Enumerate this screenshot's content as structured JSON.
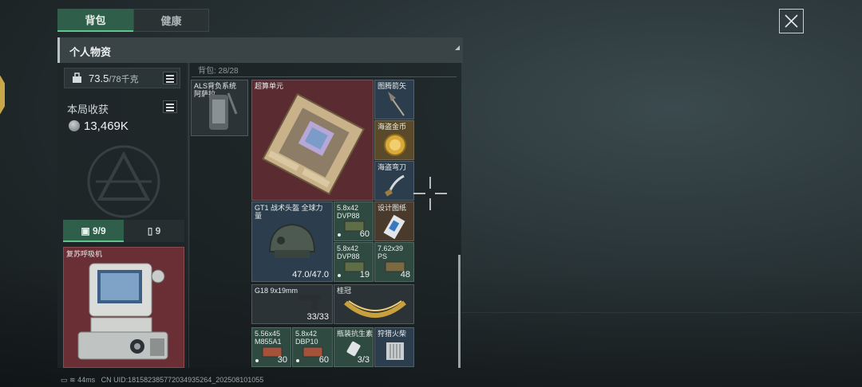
{
  "tabs": [
    "背包",
    "健康"
  ],
  "panel_title": "个人物资",
  "weight": {
    "value": "73.5",
    "max": "/78千克"
  },
  "harvest": {
    "label": "本局收获",
    "value": "13,469K"
  },
  "subtabs": {
    "case": "9/9",
    "other": "9"
  },
  "left_item": {
    "name": "复苏呼吸机"
  },
  "backpack_label": "背包: 28/28",
  "items": [
    {
      "name": "ALS背负系统 阿萨拉…",
      "qty": ""
    },
    {
      "name": "超算单元",
      "qty": ""
    },
    {
      "name": "图腾箭矢",
      "qty": ""
    },
    {
      "name": "海盗金币",
      "qty": ""
    },
    {
      "name": "海盗弯刀",
      "qty": ""
    },
    {
      "name": "GT1 战术头盔 全球力量",
      "qty": "47.0/47.0"
    },
    {
      "name": "5.8x42 DVP88",
      "qty": "60"
    },
    {
      "name": "设计图纸",
      "qty": ""
    },
    {
      "name": "5.8x42 DVP88",
      "qty": "19"
    },
    {
      "name": "7.62x39 PS",
      "qty": "48"
    },
    {
      "name": "G18 9x19mm",
      "qty": "33/33"
    },
    {
      "name": "桂冠",
      "qty": ""
    },
    {
      "name": "5.56x45 M855A1",
      "qty": "30"
    },
    {
      "name": "5.8x42 DBP10",
      "qty": "60"
    },
    {
      "name": "瓶装抗生素",
      "qty": "3/3"
    },
    {
      "name": "狩猎火柴",
      "qty": ""
    }
  ],
  "status": {
    "ping": "44ms",
    "uid": "CN UID:18158238577203493526​4_202508101055"
  },
  "colors": {
    "accent_green": "#5ec489",
    "tab_green": "#2f5e4a",
    "rare_red": "#5a2b30"
  }
}
